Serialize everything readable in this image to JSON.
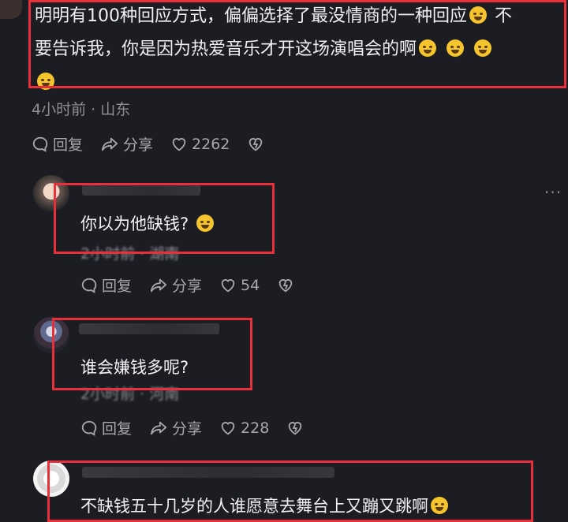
{
  "main_comment": {
    "line1": "明明有100种回应方式，偏偏选择了最没情商的一种回应",
    "line1_end": "不",
    "line2": "要告诉我，你是因为热爱音乐才开这场演唱会的啊",
    "time_location": "4小时前 · 山东",
    "reply_label": "回复",
    "share_label": "分享",
    "like_count": "2262"
  },
  "replies": [
    {
      "text": "你以为他缺钱?",
      "time_location": "2小时前 · 湖南",
      "reply_label": "回复",
      "share_label": "分享",
      "like_count": "54"
    },
    {
      "text": "谁会嫌钱多呢?",
      "time_location": "2小时前 · 河南",
      "reply_label": "回复",
      "share_label": "分享",
      "like_count": "228"
    },
    {
      "text": "不缺钱五十几岁的人谁愿意去舞台上又蹦又跳啊"
    }
  ],
  "colors": {
    "highlight": "#e8303a",
    "background": "#1c1d22"
  },
  "icons": [
    "comment-icon",
    "share-icon",
    "heart-icon",
    "dislike-heart-icon",
    "more-icon",
    "emoji-icon"
  ]
}
